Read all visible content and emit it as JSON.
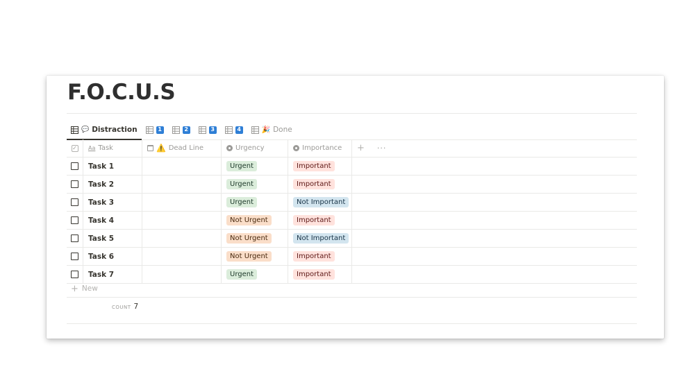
{
  "page": {
    "title": "F.O.C.U.S"
  },
  "tabs": [
    {
      "icon": "table-icon",
      "emoji": "💬",
      "label": "Distraction",
      "active": true
    },
    {
      "icon": "table-icon",
      "badge": "1",
      "label": ""
    },
    {
      "icon": "table-icon",
      "badge": "2",
      "label": ""
    },
    {
      "icon": "table-icon",
      "badge": "3",
      "label": ""
    },
    {
      "icon": "table-icon",
      "badge": "4",
      "label": ""
    },
    {
      "icon": "table-icon",
      "emoji": "🎉",
      "label": "Done"
    }
  ],
  "columns": {
    "task": {
      "prefix": "Aa",
      "label": "Task"
    },
    "deadline": {
      "emoji": "⚠️",
      "label": "Dead Line"
    },
    "urgency": {
      "label": "Urgency"
    },
    "importance": {
      "label": "Importance"
    },
    "add": "+",
    "more": "···"
  },
  "rows": [
    {
      "task": "Task 1",
      "urgency": "Urgent",
      "importance": "Important"
    },
    {
      "task": "Task 2",
      "urgency": "Urgent",
      "importance": "Important"
    },
    {
      "task": "Task 3",
      "urgency": "Urgent",
      "importance": "Not Important"
    },
    {
      "task": "Task 4",
      "urgency": "Not Urgent",
      "importance": "Important"
    },
    {
      "task": "Task 5",
      "urgency": "Not Urgent",
      "importance": "Not Important"
    },
    {
      "task": "Task 6",
      "urgency": "Not Urgent",
      "importance": "Important"
    },
    {
      "task": "Task 7",
      "urgency": "Urgent",
      "importance": "Important"
    }
  ],
  "tag_colors": {
    "Urgent": {
      "bg": "#dbeddb",
      "fg": "#1c3829"
    },
    "Not Urgent": {
      "bg": "#fadec9",
      "fg": "#49290e"
    },
    "Important": {
      "bg": "#ffe2dd",
      "fg": "#5d1715"
    },
    "Not Important": {
      "bg": "#d3e5ef",
      "fg": "#183347"
    }
  },
  "new_row": {
    "plus": "+",
    "label": "New"
  },
  "footer": {
    "count_label": "COUNT",
    "count_value": "7"
  }
}
